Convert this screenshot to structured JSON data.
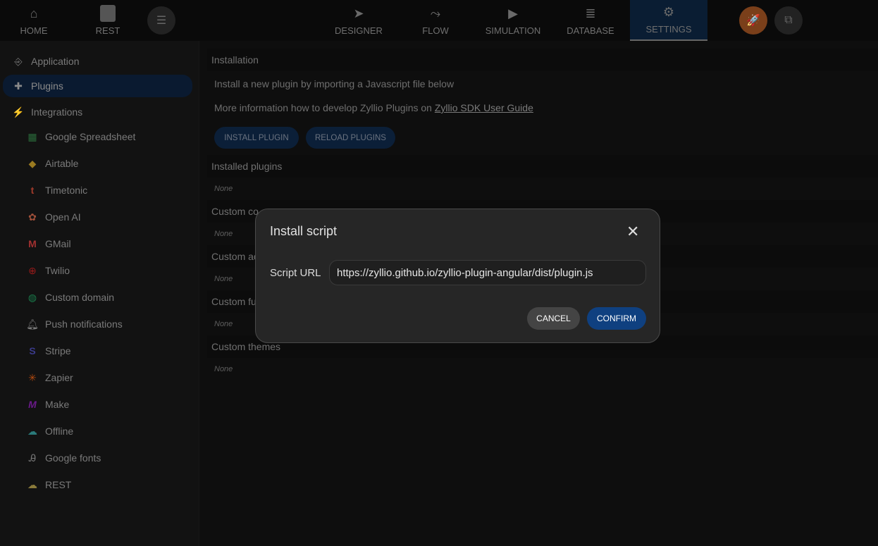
{
  "topbar": {
    "left": [
      {
        "label": "HOME",
        "icon": "home-icon"
      },
      {
        "label": "REST",
        "icon": "document-icon"
      }
    ],
    "tabs": [
      {
        "label": "DESIGNER",
        "icon": "cursor-icon"
      },
      {
        "label": "FLOW",
        "icon": "flow-icon"
      },
      {
        "label": "SIMULATION",
        "icon": "play-icon"
      },
      {
        "label": "DATABASE",
        "icon": "database-icon"
      },
      {
        "label": "SETTINGS",
        "icon": "gear-icon"
      }
    ],
    "active_tab": "SETTINGS",
    "colors": {
      "accent": "#0a1d33",
      "rocket": "#8a4a20"
    }
  },
  "sidebar": {
    "items": [
      {
        "label": "Application"
      },
      {
        "label": "Plugins"
      },
      {
        "label": "Integrations"
      }
    ],
    "integrations": [
      {
        "label": "Google Spreadsheet"
      },
      {
        "label": "Airtable"
      },
      {
        "label": "Timetonic"
      },
      {
        "label": "Open AI"
      },
      {
        "label": "GMail"
      },
      {
        "label": "Twilio"
      },
      {
        "label": "Custom domain"
      },
      {
        "label": "Push notifications"
      },
      {
        "label": "Stripe"
      },
      {
        "label": "Zapier"
      },
      {
        "label": "Make"
      },
      {
        "label": "Offline"
      },
      {
        "label": "Google fonts"
      },
      {
        "label": "REST"
      }
    ]
  },
  "main": {
    "installation_header": "Installation",
    "intro": "Install a new plugin by importing a Javascript file below",
    "more_info": "More information how to develop Zyllio Plugins on",
    "link": "Zyllio SDK User Guide",
    "install_button": "INSTALL PLUGIN",
    "reload_button": "RELOAD PLUGINS",
    "sections": [
      {
        "title": "Installed plugins",
        "value": "None"
      },
      {
        "title": "Custom co",
        "value": "None"
      },
      {
        "title": "Custom ac",
        "value": "None"
      },
      {
        "title": "Custom fu",
        "value": "None"
      },
      {
        "title": "Custom themes",
        "value": "None"
      }
    ]
  },
  "modal": {
    "title": "Install script",
    "label": "Script URL",
    "url": "https://zyllio.github.io/zyllio-plugin-angular/dist/plugin.js",
    "cancel": "CANCEL",
    "confirm": "CONFIRM"
  }
}
